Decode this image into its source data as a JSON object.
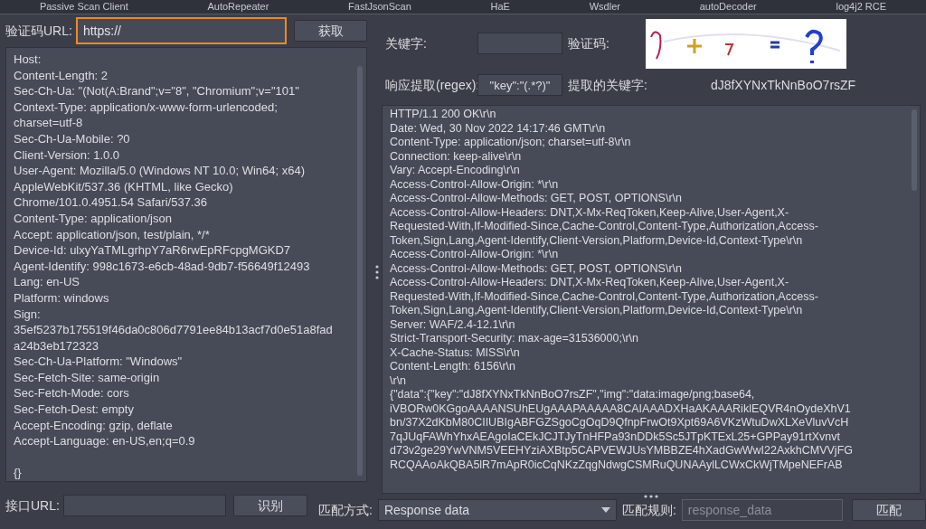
{
  "tabs": [
    {
      "label": "Passive Scan Client",
      "selected": false
    },
    {
      "label": "AutoRepeater",
      "selected": false
    },
    {
      "label": "FastJsonScan",
      "selected": false
    },
    {
      "label": "HaE",
      "selected": false
    },
    {
      "label": "Wsdler",
      "selected": false
    },
    {
      "label": "autoDecoder",
      "selected": false
    },
    {
      "label": "log4j2 RCE",
      "selected": false
    }
  ],
  "captcha_url": {
    "label": "验证码URL:",
    "value": "https://",
    "focused": true,
    "button": "获取"
  },
  "request_text": [
    "Host:",
    "Content-Length: 2",
    "Sec-Ch-Ua: \"(Not(A:Brand\";v=\"8\", \"Chromium\";v=\"101\"",
    "Context-Type: application/x-www-form-urlencoded;",
    "charset=utf-8",
    "Sec-Ch-Ua-Mobile: ?0",
    "Client-Version: 1.0.0",
    "User-Agent: Mozilla/5.0 (Windows NT 10.0; Win64; x64)",
    "AppleWebKit/537.36 (KHTML, like Gecko)",
    "Chrome/101.0.4951.54 Safari/537.36",
    "Content-Type: application/json",
    "Accept: application/json, test/plain, */*",
    "Device-Id: ulxyYaTMLgrhpY7aR6rwEpRFcpgMGKD7",
    "Agent-Identify: 998c1673-e6cb-48ad-9db7-f56649f12493",
    "Lang: en-US",
    "Platform: windows",
    "Sign:",
    "35ef5237b175519f46da0c806d7791ee84b13acf7d0e51a8fad",
    "a24b3eb172323",
    "Sec-Ch-Ua-Platform: \"Windows\"",
    "Sec-Fetch-Site: same-origin",
    "Sec-Fetch-Mode: cors",
    "Sec-Fetch-Dest: empty",
    "Accept-Encoding: gzip, deflate",
    "Accept-Language: en-US,en;q=0.9"
  ],
  "request_body": "{}",
  "keyword": {
    "label": "关键字:"
  },
  "captcha": {
    "label": "验证码:"
  },
  "regex": {
    "label": "响应提取(regex):",
    "value": "\"key\":\"(.*?)\""
  },
  "extracted": {
    "label": "提取的关键字:",
    "value": "dJ8fXYNxTkNnBoO7rsZF"
  },
  "response_text": [
    "HTTP/1.1 200 OK\\r\\n",
    "Date: Wed, 30 Nov 2022 14:17:46 GMT\\r\\n",
    "Content-Type: application/json; charset=utf-8\\r\\n",
    "Connection: keep-alive\\r\\n",
    "Vary: Accept-Encoding\\r\\n",
    "Access-Control-Allow-Origin: *\\r\\n",
    "Access-Control-Allow-Methods: GET, POST, OPTIONS\\r\\n",
    "Access-Control-Allow-Headers: DNT,X-Mx-ReqToken,Keep-Alive,User-Agent,X-",
    "Requested-With,If-Modified-Since,Cache-Control,Content-Type,Authorization,Access-",
    "Token,Sign,Lang,Agent-Identify,Client-Version,Platform,Device-Id,Context-Type\\r\\n",
    "Access-Control-Allow-Origin: *\\r\\n",
    "Access-Control-Allow-Methods: GET, POST, OPTIONS\\r\\n",
    "Access-Control-Allow-Headers: DNT,X-Mx-ReqToken,Keep-Alive,User-Agent,X-",
    "Requested-With,If-Modified-Since,Cache-Control,Content-Type,Authorization,Access-",
    "Token,Sign,Lang,Agent-Identify,Client-Version,Platform,Device-Id,Context-Type\\r\\n",
    "Server: WAF/2.4-12.1\\r\\n",
    "Strict-Transport-Security: max-age=31536000;\\r\\n",
    "X-Cache-Status: MISS\\r\\n",
    "Content-Length: 6156\\r\\n",
    "\\r\\n",
    "{\"data\":{\"key\":\"dJ8fXYNxTkNnBoO7rsZF\",\"img\":\"data:image/png;base64,",
    "iVBORw0KGgoAAAANSUhEUgAAAPAAAAA8CAIAAADXHaAKAAARiklEQVR4nOydeXhV1",
    "bn/37X2dKbM80CIIUBIgABFGZSgoCgOqD9QfnpFrwOt9Xpt69A6VKzWtuDwXLXeVluvVcH",
    "7qJUqFAWhYhxAEAgoIaCEkJCJTJyTnHFPa93nDDk5Sc5JTpKTExL25+GPPay91rtXvnvt",
    "d73v2ge29YwVNM5VEEHYziAXBtp5CAPVEWJUsYMBBZE4hXadGwWwI22AxkhCMVVjFG",
    "RCQAAoAkQBA5lR7mApR0icCqNKzZqgNdwgCSMRuQUNAAylLCWxCkWjTMpeNEFrAB"
  ],
  "interface_url": {
    "label": "接口URL:",
    "button": "识别"
  },
  "match_mode": {
    "label": "匹配方式:",
    "value": "Response data"
  },
  "match_rule": {
    "label": "匹配规则:",
    "placeholder": "response_data",
    "button": "匹配"
  }
}
